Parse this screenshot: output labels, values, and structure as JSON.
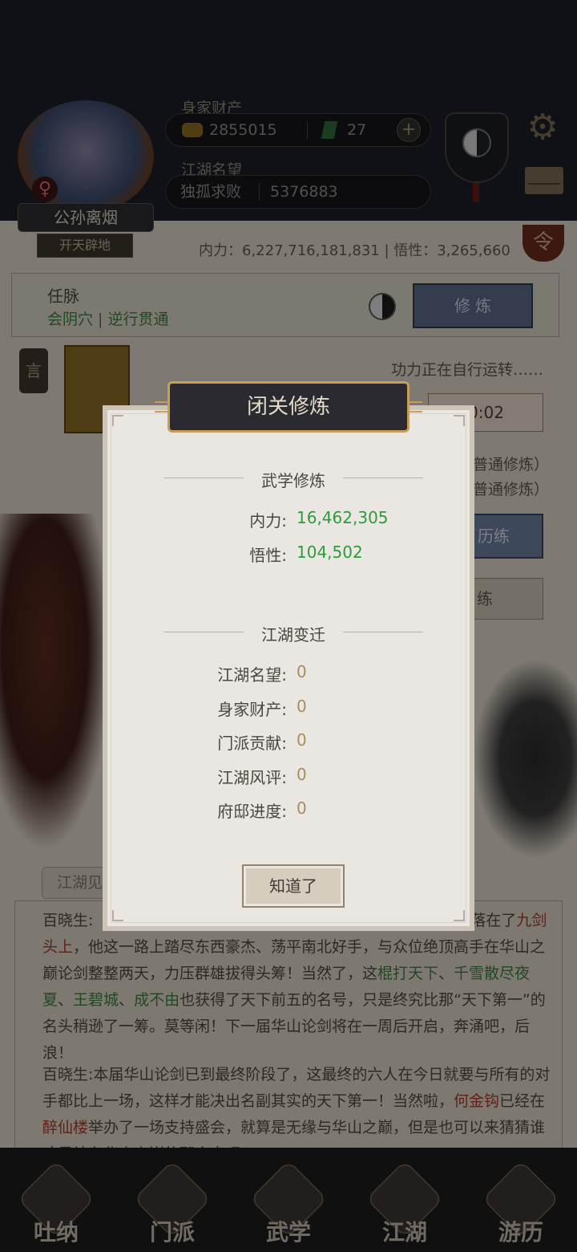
{
  "player": {
    "name": "公孙离烟",
    "title": "开天辟地",
    "gender_symbol": "♀"
  },
  "wealth": {
    "label": "身家财产",
    "coins": "2855015",
    "gems": "27",
    "plus": "+"
  },
  "reputation": {
    "label": "江湖名望",
    "rank": "独孤求败",
    "value": "5376883"
  },
  "power_line": "内力：6,227,716,181,831 | 悟性：3,265,660",
  "ling_badge": "令",
  "meridian": {
    "title": "任脉",
    "subtitle": "会阴穴 | 逆行贯通",
    "train_button": "修 炼"
  },
  "yan_tag": "言",
  "running_text": "功力正在自行运转……",
  "timer": "0:02",
  "bg_mode_1": "普通修炼）",
  "bg_mode_2": "普通修炼）",
  "bg_btn_1": "历练",
  "bg_btn_2": "练",
  "log_tab": "江湖见",
  "log": {
    "p1_a": "百晓生:",
    "p1_b": "名号名副其实地落在了",
    "p1_c": "九剑头上",
    "p1_d": "，他这一路上踏尽东西豪杰、荡平南北好手，与众位绝顶高手在华山之巅论剑整整两天，力压群雄拔得头筹！当然了，这",
    "p1_e": "棍打天下",
    "p1_f": "、",
    "p1_g": "千雪散尽夜夏",
    "p1_h": "、",
    "p1_i": "王碧城",
    "p1_j": "、",
    "p1_k": "成不由",
    "p1_l": "也获得了天下前五的名号，只是终究比那“天下第一”的名头稍逊了一筹。莫等闲！下一届华山论剑将在一周后开启，奔涌吧，后浪！",
    "p2_a": "百晓生:本届华山论剑已到最终阶段了，这最终的六人在今日就要与所有的对手都比上一场，这样才能决出名副其实的天下第一！当然啦，",
    "p2_b": "何金钩",
    "p2_c": "已经在",
    "p2_d": "醉仙楼",
    "p2_e": "举办了一场支持盛会，就算是无缘与华山之巅，但是也可以来猜猜谁才是站在华山之巅的那个人吧！"
  },
  "nav": [
    {
      "label": "吐纳",
      "icon": "meditate-icon"
    },
    {
      "label": "门派",
      "icon": "sect-icon"
    },
    {
      "label": "武学",
      "icon": "martial-book-icon"
    },
    {
      "label": "江湖",
      "icon": "hat-icon"
    },
    {
      "label": "游历",
      "icon": "horse-icon"
    }
  ],
  "dialog": {
    "title": "闭关修炼",
    "section1": "武学修炼",
    "neili_label": "内力:",
    "neili_value": "16,462,305",
    "wuxing_label": "悟性:",
    "wuxing_value": "104,502",
    "section2": "江湖变迁",
    "rows": [
      {
        "label": "江湖名望:",
        "value": "0"
      },
      {
        "label": "身家财产:",
        "value": "0"
      },
      {
        "label": "门派贡献:",
        "value": "0"
      },
      {
        "label": "江湖风评:",
        "value": "0"
      },
      {
        "label": "府邸进度:",
        "value": "0"
      }
    ],
    "ok_button": "知道了"
  },
  "colors": {
    "gain_green": "#2f9a3a",
    "zero_tan": "#a88f5a",
    "header_gold": "#c79d5a"
  }
}
